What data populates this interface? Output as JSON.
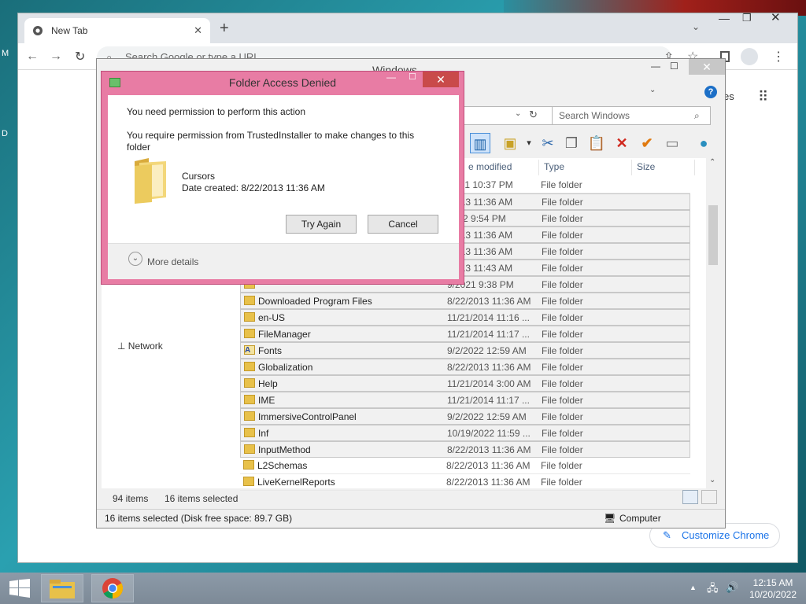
{
  "desktop": {
    "edge_left_top": "M",
    "edge_left_mid": "D"
  },
  "chrome": {
    "tab_title": "New Tab",
    "new_tab_symbol": "+",
    "omnibox_placeholder": "Search Google or type a URL",
    "right_partial_text": "es",
    "customize_label": "Customize Chrome"
  },
  "explorer": {
    "title": "Windows",
    "search_placeholder": "Search Windows",
    "columns": {
      "date": "e modified",
      "type": "Type",
      "size": "Size"
    },
    "nav_network": "Network",
    "files": [
      {
        "name": "",
        "date": "/2021 10:37 PM",
        "type": "File folder",
        "icon": "folder-icon",
        "selected": false
      },
      {
        "name": "",
        "date": "/2013 11:36 AM",
        "type": "File folder",
        "icon": "folder-icon",
        "selected": true
      },
      {
        "name": "",
        "date": "2022 9:54 PM",
        "type": "File folder",
        "icon": "folder-icon",
        "selected": true
      },
      {
        "name": "",
        "date": "/2013 11:36 AM",
        "type": "File folder",
        "icon": "folder-icon",
        "selected": true
      },
      {
        "name": "",
        "date": "/2013 11:36 AM",
        "type": "File folder",
        "icon": "folder-icon",
        "selected": true
      },
      {
        "name": "",
        "date": "/2013 11:43 AM",
        "type": "File folder",
        "icon": "folder-icon",
        "selected": true
      },
      {
        "name": "",
        "date": "9/2021 9:38 PM",
        "type": "File folder",
        "icon": "folder-icon",
        "selected": true
      },
      {
        "name": "Downloaded Program Files",
        "date": "8/22/2013 11:36 AM",
        "type": "File folder",
        "icon": "folder-icon",
        "selected": true
      },
      {
        "name": "en-US",
        "date": "11/21/2014 11:16 ...",
        "type": "File folder",
        "icon": "folder-icon",
        "selected": true
      },
      {
        "name": "FileManager",
        "date": "11/21/2014 11:17 ...",
        "type": "File folder",
        "icon": "folder-icon",
        "selected": true
      },
      {
        "name": "Fonts",
        "date": "9/2/2022 12:59 AM",
        "type": "File folder",
        "icon": "fonts-folder-icon",
        "selected": true
      },
      {
        "name": "Globalization",
        "date": "8/22/2013 11:36 AM",
        "type": "File folder",
        "icon": "folder-icon",
        "selected": true
      },
      {
        "name": "Help",
        "date": "11/21/2014 3:00 AM",
        "type": "File folder",
        "icon": "folder-icon",
        "selected": true
      },
      {
        "name": "IME",
        "date": "11/21/2014 11:17 ...",
        "type": "File folder",
        "icon": "folder-icon",
        "selected": true
      },
      {
        "name": "ImmersiveControlPanel",
        "date": "9/2/2022 12:59 AM",
        "type": "File folder",
        "icon": "folder-icon",
        "selected": true
      },
      {
        "name": "Inf",
        "date": "10/19/2022 11:59 ...",
        "type": "File folder",
        "icon": "folder-icon",
        "selected": true
      },
      {
        "name": "InputMethod",
        "date": "8/22/2013 11:36 AM",
        "type": "File folder",
        "icon": "folder-icon",
        "selected": true
      },
      {
        "name": "L2Schemas",
        "date": "8/22/2013 11:36 AM",
        "type": "File folder",
        "icon": "folder-icon",
        "selected": false
      },
      {
        "name": "LiveKernelReports",
        "date": "8/22/2013 11:36 AM",
        "type": "File folder",
        "icon": "folder-icon",
        "selected": false
      }
    ],
    "item_count": "94 items",
    "selected_count": "16 items selected",
    "status_left": "16 items selected (Disk free space: 89.7 GB)",
    "status_right": "Computer"
  },
  "dialog": {
    "title": "Folder Access Denied",
    "message1": "You need permission to perform this action",
    "message2": "You require permission from TrustedInstaller to make changes to this folder",
    "item_name": "Cursors",
    "item_date": "Date created: 8/22/2013 11:36 AM",
    "try_again": "Try Again",
    "cancel": "Cancel",
    "more_details": "More details"
  },
  "taskbar": {
    "time": "12:15 AM",
    "date": "10/20/2022"
  },
  "colors": {
    "dialog_frame": "#e87ca4",
    "close_red": "#c94a4a",
    "folder_yellow": "#e8c14a",
    "chrome_blue": "#1a73e8"
  }
}
